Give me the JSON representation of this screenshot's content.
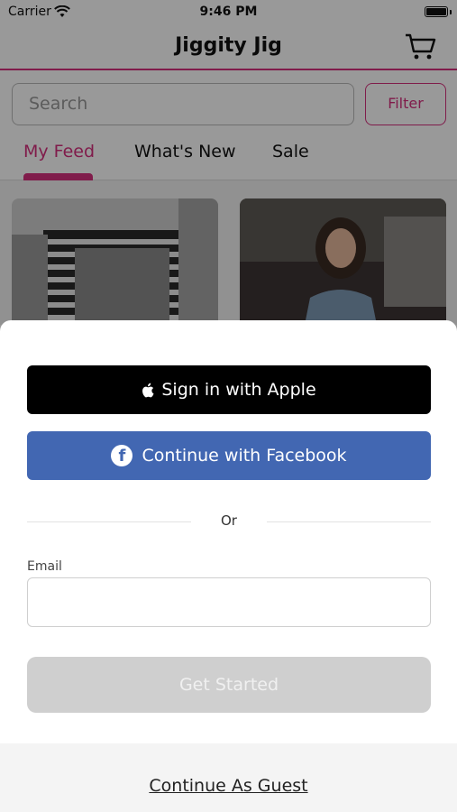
{
  "status_bar": {
    "carrier": "Carrier",
    "time": "9:46 PM"
  },
  "header": {
    "title": "Jiggity Jig"
  },
  "search": {
    "placeholder": "Search",
    "filter_label": "Filter"
  },
  "tabs": [
    {
      "label": "My Feed",
      "active": true
    },
    {
      "label": "What's New",
      "active": false
    },
    {
      "label": "Sale",
      "active": false
    }
  ],
  "sheet": {
    "apple_label": "Sign in with Apple",
    "facebook_label": "Continue with Facebook",
    "or_text": "Or",
    "email_label": "Email",
    "email_value": "",
    "get_started_label": "Get Started",
    "guest_label": "Continue As Guest"
  },
  "colors": {
    "accent": "#d6307d",
    "facebook": "#4267b2",
    "apple": "#000000",
    "disabled": "#cfcfcf"
  }
}
